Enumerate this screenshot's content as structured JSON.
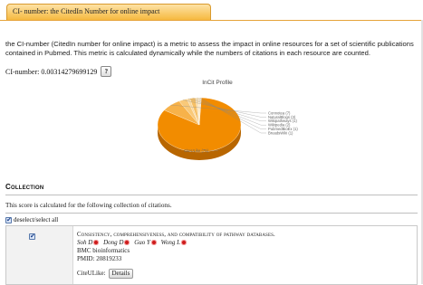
{
  "tab": {
    "label": "CI- number: the CitedIn Number for online impact"
  },
  "intro": "the CI-number (CitedIn number for online impact) is a metric to assess the impact in online resources for a set of scientific publications contained in Pubmed. This metric is calculated dynamically while the numbers of citations in each resource are counted.",
  "ci_number": {
    "label": "CI-number: 0.00314279699129",
    "help_label": "?"
  },
  "chart_data": {
    "type": "pie",
    "title": "InCit Profile",
    "slices": [
      {
        "label": "CiteULike (75)",
        "value": 75,
        "color": "#f28c00"
      },
      {
        "label": "Connotea (7)",
        "value": 7,
        "color": "#f7b24a"
      },
      {
        "label": "NaturalBlogs (3)",
        "value": 3,
        "color": "#f9c979"
      },
      {
        "label": "Wikipathways (1)",
        "value": 1,
        "color": "#fad79b"
      },
      {
        "label": "Wikipedia (2)",
        "value": 2,
        "color": "#f6c066"
      },
      {
        "label": "PubmedBioEx (1)",
        "value": 1,
        "color": "#fbe0b0"
      },
      {
        "label": "BreadsWiki (1)",
        "value": 1,
        "color": "#fce8c6"
      }
    ],
    "colors": {
      "side": "#b86600"
    }
  },
  "collection": {
    "header": "Collection",
    "description": "This score is calculated for the following collection of citations.",
    "deselect_label": "deselect/select all"
  },
  "entry": {
    "title": "Consistency, comprehensiveness, and compatibility of pathway databases.",
    "authors": [
      "Soh D",
      "Dong D",
      "Guo Y",
      "Wong L"
    ],
    "journal": "BMC bioinformatics",
    "pmid": "PMID: 20819233",
    "source_label": "CiteULike:",
    "details_label": "Details",
    "colors": {
      "author_dot": "#cc1b1b"
    }
  }
}
